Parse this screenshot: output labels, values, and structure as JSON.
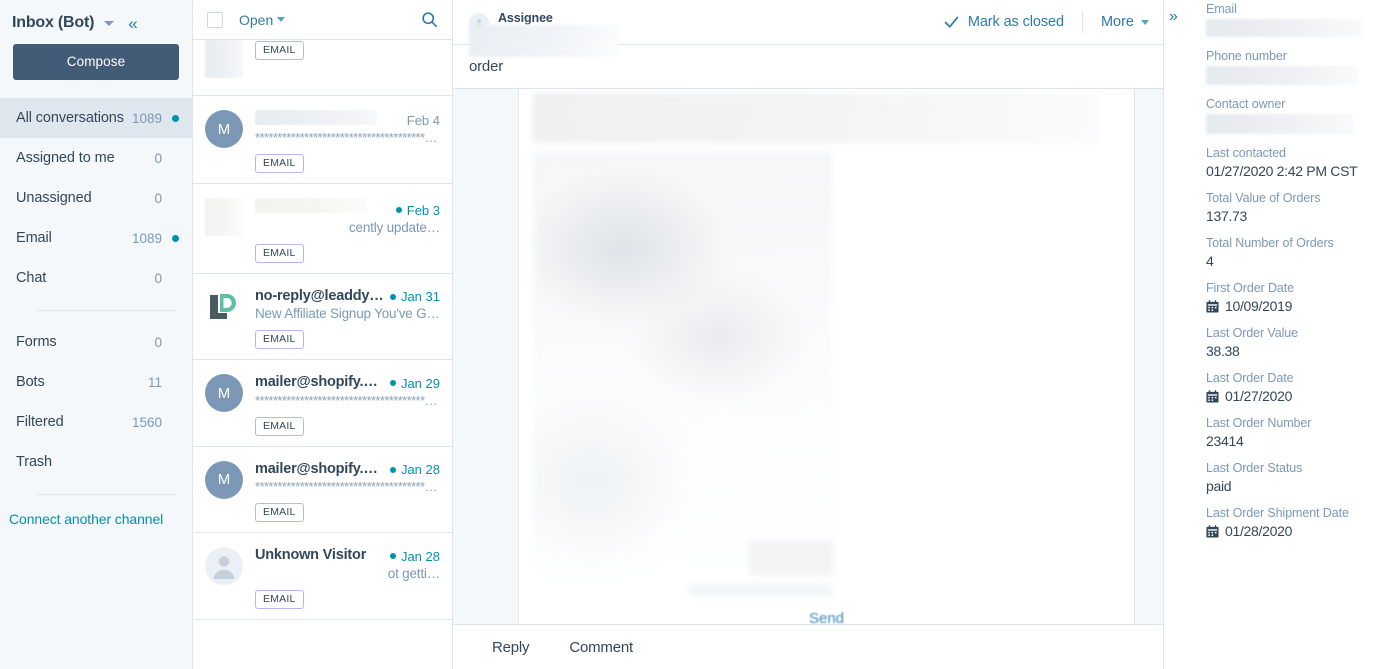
{
  "sidebar": {
    "title": "Inbox (Bot)",
    "collapse_icon": "double-chevron-left-icon",
    "compose_label": "Compose",
    "items": [
      {
        "label": "All conversations",
        "count": "1089",
        "dot": true,
        "active": true
      },
      {
        "label": "Assigned to me",
        "count": "0",
        "dot": false,
        "active": false
      },
      {
        "label": "Unassigned",
        "count": "0",
        "dot": false,
        "active": false
      },
      {
        "label": "Email",
        "count": "1089",
        "dot": true,
        "active": false
      },
      {
        "label": "Chat",
        "count": "0",
        "dot": false,
        "active": false
      }
    ],
    "items2": [
      {
        "label": "Forms",
        "count": "0",
        "dot": false
      },
      {
        "label": "Bots",
        "count": "11",
        "dot": false
      },
      {
        "label": "Filtered",
        "count": "1560",
        "dot": false
      },
      {
        "label": "Trash",
        "count": "",
        "dot": false
      }
    ],
    "connect_label": "Connect another channel"
  },
  "list": {
    "select_all_name": "select-all-checkbox",
    "filter_label": "Open",
    "search_icon": "search-icon",
    "items": [
      {
        "clipped": true,
        "name": "",
        "date": "",
        "dot": false,
        "preview": "",
        "badge": "EMAIL",
        "avatar_type": "redacted",
        "avatar_letter": ""
      },
      {
        "clipped": false,
        "name": "",
        "date": "Feb 4",
        "dot": false,
        "preview": "*******************************************",
        "badge": "EMAIL",
        "avatar_type": "letter",
        "avatar_letter": "M"
      },
      {
        "clipped": false,
        "name": "",
        "date": "Feb 3",
        "dot": true,
        "preview": "cently update…",
        "badge": "EMAIL",
        "avatar_type": "redacted",
        "avatar_letter": ""
      },
      {
        "clipped": false,
        "name": "no-reply@leaddyno…",
        "date": "Jan 31",
        "dot": true,
        "preview": "New Affiliate Signup You've Got …",
        "badge": "EMAIL",
        "avatar_type": "leaddyno",
        "avatar_letter": ""
      },
      {
        "clipped": false,
        "name": "mailer@shopify.com",
        "date": "Jan 29",
        "dot": true,
        "preview": "*******************************************",
        "badge": "EMAIL",
        "avatar_type": "letter",
        "avatar_letter": "M"
      },
      {
        "clipped": false,
        "name": "mailer@shopify.com",
        "date": "Jan 28",
        "dot": true,
        "preview": "*******************************************",
        "badge": "EMAIL",
        "avatar_type": "letter",
        "avatar_letter": "M"
      },
      {
        "clipped": false,
        "name": "Unknown Visitor",
        "date": "Jan 28",
        "dot": true,
        "preview": "ot getti…",
        "badge": "EMAIL",
        "avatar_type": "person",
        "avatar_letter": ""
      }
    ]
  },
  "conversation": {
    "assignee_label": "Assignee",
    "mark_closed_label": "Mark as closed",
    "more_label": "More",
    "subject": "order",
    "send_label": "Send",
    "reply_tab": "Reply",
    "comment_tab": "Comment"
  },
  "contact": {
    "expand_icon": "double-chevron-right-icon",
    "fields": [
      {
        "label": "Email",
        "value": "",
        "redacted": true,
        "calendar": false
      },
      {
        "label": "Phone number",
        "value": "",
        "redacted": true,
        "calendar": false
      },
      {
        "label": "Contact owner",
        "value": "",
        "redacted": true,
        "calendar": false
      },
      {
        "label": "Last contacted",
        "value": "01/27/2020 2:42 PM CST",
        "redacted": false,
        "calendar": false
      },
      {
        "label": "Total Value of Orders",
        "value": "137.73",
        "redacted": false,
        "calendar": false
      },
      {
        "label": "Total Number of Orders",
        "value": "4",
        "redacted": false,
        "calendar": false
      },
      {
        "label": "First Order Date",
        "value": "10/09/2019",
        "redacted": false,
        "calendar": true
      },
      {
        "label": "Last Order Value",
        "value": "38.38",
        "redacted": false,
        "calendar": false
      },
      {
        "label": "Last Order Date",
        "value": "01/27/2020",
        "redacted": false,
        "calendar": true
      },
      {
        "label": "Last Order Number",
        "value": "23414",
        "redacted": false,
        "calendar": false
      },
      {
        "label": "Last Order Status",
        "value": "paid",
        "redacted": false,
        "calendar": false
      },
      {
        "label": "Last Order Shipment Date",
        "value": "01/28/2020",
        "redacted": false,
        "calendar": true
      }
    ]
  },
  "colors": {
    "brand_navy": "#33475b",
    "link_blue": "#2e7ba6",
    "teal_accent": "#0091ae",
    "muted": "#7c98b6",
    "compose_bg": "#425b76",
    "panel_bg": "#f5f8fa",
    "border": "#dfe3eb"
  }
}
